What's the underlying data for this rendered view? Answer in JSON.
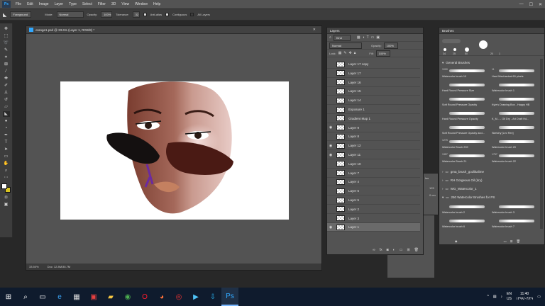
{
  "menu": [
    "File",
    "Edit",
    "Image",
    "Layer",
    "Type",
    "Select",
    "Filter",
    "3D",
    "View",
    "Window",
    "Help"
  ],
  "app_logo": "Ps",
  "options": {
    "preset": "Foreground",
    "mode_label": "Mode:",
    "mode_value": "Normal",
    "opacity_label": "Opacity:",
    "opacity_value": "100%",
    "tolerance_label": "Tolerance:",
    "tolerance_value": "32",
    "antialias": "Anti-alias",
    "contiguous": "Contiguous",
    "all_layers": "All Layers"
  },
  "document": {
    "tab_title": "orange1.psd @ 33.6% (Layer 1, RGB/8) *",
    "zoom": "33.50%",
    "doc_size": "Doc: 12.8M/35.7M"
  },
  "layers_panel": {
    "title": "Layers",
    "kind": "Kind",
    "blend": "Normal",
    "opacity_label": "Opacity:",
    "opacity_value": "100%",
    "lock_label": "Lock:",
    "fill_label": "Fill:",
    "fill_value": "100%",
    "layers": [
      {
        "name": "Layer 17 copy",
        "visible": false
      },
      {
        "name": "Layer 17",
        "visible": false
      },
      {
        "name": "Layer 16",
        "visible": false
      },
      {
        "name": "Layer 15",
        "visible": false
      },
      {
        "name": "Layer 14",
        "visible": false
      },
      {
        "name": "Exposure 1",
        "visible": false
      },
      {
        "name": "Gradient Map 1",
        "visible": false
      },
      {
        "name": "Layer 9",
        "visible": true
      },
      {
        "name": "Layer 8",
        "visible": false
      },
      {
        "name": "Layer 12",
        "visible": true
      },
      {
        "name": "Layer 11",
        "visible": true
      },
      {
        "name": "Layer 10",
        "visible": false
      },
      {
        "name": "Layer 7",
        "visible": false
      },
      {
        "name": "Layer 4",
        "visible": false
      },
      {
        "name": "Layer 6",
        "visible": false
      },
      {
        "name": "Layer 5",
        "visible": false
      },
      {
        "name": "Layer 2",
        "visible": false
      },
      {
        "name": "Layer 3",
        "visible": false
      },
      {
        "name": "Layer 1",
        "visible": true
      }
    ]
  },
  "brushes_panel": {
    "title": "Brushes",
    "sizes": [
      "34",
      "25",
      "50",
      "20",
      "1"
    ],
    "general_group": "General Brushes",
    "items": [
      {
        "num": "1000",
        "name": "Watercolor brush 10"
      },
      {
        "num": "11",
        "name": "Hard Mechanical 60 pixels"
      },
      {
        "num": "",
        "name": "Hard Round Pressure Size"
      },
      {
        "num": "",
        "name": "Watercolor brush 1"
      },
      {
        "num": "",
        "name": "Soft Round Pressure Opacity"
      },
      {
        "num": "",
        "name": "Kyle's Drawing Box - Happy HB"
      },
      {
        "num": "",
        "name": "Hard Round Pressure Opacity"
      },
      {
        "num": "",
        "name": "K_M... - Oil Dry - Art Draft Hd..."
      },
      {
        "num": "",
        "name": "Soft Round Pressure Opacity and..."
      },
      {
        "num": "",
        "name": "Sketchy [Lev Rev]"
      },
      {
        "num": "1275",
        "name": "Watercolor Brush 239"
      },
      {
        "num": "",
        "name": "Watercolor brush 20"
      },
      {
        "num": "1357",
        "name": "Watercolor Brush 21"
      },
      {
        "num": "1757",
        "name": "Watercolor brush 22"
      }
    ],
    "folders": [
      "gma_brush_gozlikalime",
      "RH Gorgeous Oil (dry)",
      "WG_Watercolor_1",
      "250 Watercolor Brushes for PS"
    ],
    "items2": [
      {
        "num": "",
        "name": "Watercolor brush 2"
      },
      {
        "num": "",
        "name": "Watercolor brush 3"
      },
      {
        "num": "",
        "name": "Watercolor brush 6"
      },
      {
        "num": "",
        "name": "Watercolor brush 7"
      }
    ]
  },
  "mini_panel": {
    "l1": "les",
    "l2": "125",
    "l3": "0 cm"
  },
  "taskbar": {
    "lang1": "EN",
    "lang2": "US",
    "time": "11:40",
    "date": "۱۳۹۹/۰۴/۲۹"
  }
}
